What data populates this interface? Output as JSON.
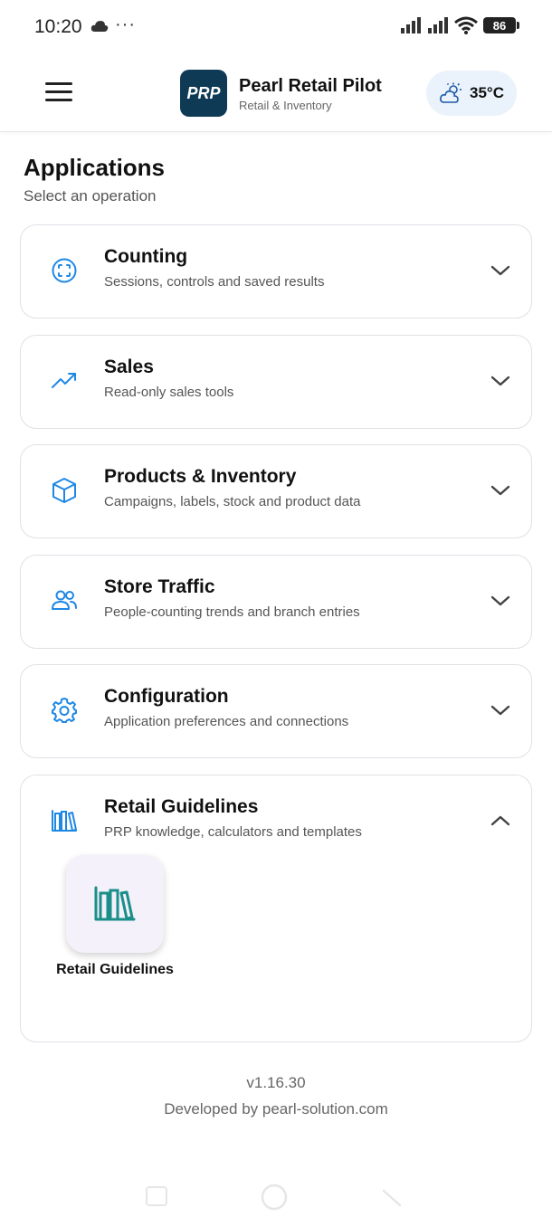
{
  "status_bar": {
    "time": "10:20",
    "battery": "86"
  },
  "header": {
    "logo_text": "PRP",
    "title": "Pearl Retail Pilot",
    "subtitle": "Retail & Inventory",
    "weather_temp": "35°C"
  },
  "page": {
    "title": "Applications",
    "subtitle": "Select an operation"
  },
  "sections": [
    {
      "title": "Counting",
      "description": "Sessions, controls and saved results",
      "icon": "scan-icon",
      "expanded": false
    },
    {
      "title": "Sales",
      "description": "Read-only sales tools",
      "icon": "trending-up-icon",
      "expanded": false
    },
    {
      "title": "Products & Inventory",
      "description": "Campaigns, labels, stock and product data",
      "icon": "cube-icon",
      "expanded": false
    },
    {
      "title": "Store Traffic",
      "description": "People-counting trends and branch entries",
      "icon": "people-icon",
      "expanded": false
    },
    {
      "title": "Configuration",
      "description": "Application preferences and connections",
      "icon": "gear-icon",
      "expanded": false
    },
    {
      "title": "Retail Guidelines",
      "description": "PRP knowledge, calculators and templates",
      "icon": "books-icon",
      "expanded": true,
      "items": [
        {
          "label": "Retail Guidelines",
          "icon": "books-icon"
        }
      ]
    }
  ],
  "footer": {
    "version": "v1.16.30",
    "credit": "Developed by pearl-solution.com"
  },
  "colors": {
    "accent": "#1e88e5",
    "logo_bg": "#0f3a55",
    "tile_icon": "#1a8f8a",
    "weather_bg": "#eaf2fb"
  }
}
